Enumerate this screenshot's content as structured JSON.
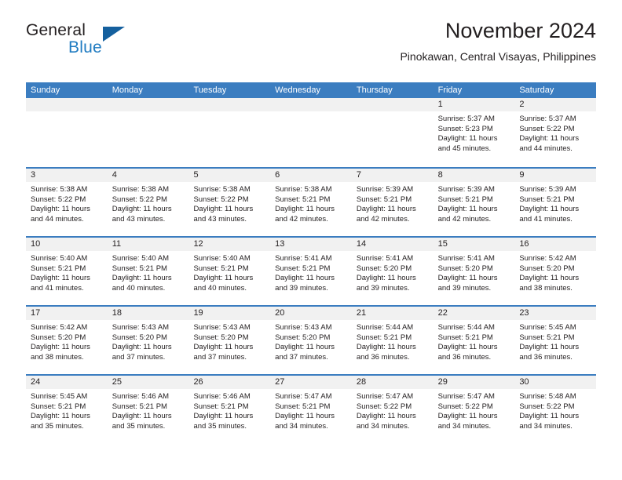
{
  "brand": {
    "name_part1": "General",
    "name_part2": "Blue",
    "flag_icon": "triangle-flag-icon"
  },
  "header": {
    "title": "November 2024",
    "subtitle": "Pinokawan, Central Visayas, Philippines"
  },
  "colors": {
    "header_blue": "#3b7dc0",
    "brand_blue": "#1f7bc1",
    "flag_blue": "#15609e",
    "day_band_gray": "#f1f1f1",
    "text": "#231f20"
  },
  "weekdays": [
    "Sunday",
    "Monday",
    "Tuesday",
    "Wednesday",
    "Thursday",
    "Friday",
    "Saturday"
  ],
  "weeks": [
    [
      {
        "day": "",
        "empty": true
      },
      {
        "day": "",
        "empty": true
      },
      {
        "day": "",
        "empty": true
      },
      {
        "day": "",
        "empty": true
      },
      {
        "day": "",
        "empty": true
      },
      {
        "day": "1",
        "sunrise": "Sunrise: 5:37 AM",
        "sunset": "Sunset: 5:23 PM",
        "daylight": "Daylight: 11 hours and 45 minutes."
      },
      {
        "day": "2",
        "sunrise": "Sunrise: 5:37 AM",
        "sunset": "Sunset: 5:22 PM",
        "daylight": "Daylight: 11 hours and 44 minutes."
      }
    ],
    [
      {
        "day": "3",
        "sunrise": "Sunrise: 5:38 AM",
        "sunset": "Sunset: 5:22 PM",
        "daylight": "Daylight: 11 hours and 44 minutes."
      },
      {
        "day": "4",
        "sunrise": "Sunrise: 5:38 AM",
        "sunset": "Sunset: 5:22 PM",
        "daylight": "Daylight: 11 hours and 43 minutes."
      },
      {
        "day": "5",
        "sunrise": "Sunrise: 5:38 AM",
        "sunset": "Sunset: 5:22 PM",
        "daylight": "Daylight: 11 hours and 43 minutes."
      },
      {
        "day": "6",
        "sunrise": "Sunrise: 5:38 AM",
        "sunset": "Sunset: 5:21 PM",
        "daylight": "Daylight: 11 hours and 42 minutes."
      },
      {
        "day": "7",
        "sunrise": "Sunrise: 5:39 AM",
        "sunset": "Sunset: 5:21 PM",
        "daylight": "Daylight: 11 hours and 42 minutes."
      },
      {
        "day": "8",
        "sunrise": "Sunrise: 5:39 AM",
        "sunset": "Sunset: 5:21 PM",
        "daylight": "Daylight: 11 hours and 42 minutes."
      },
      {
        "day": "9",
        "sunrise": "Sunrise: 5:39 AM",
        "sunset": "Sunset: 5:21 PM",
        "daylight": "Daylight: 11 hours and 41 minutes."
      }
    ],
    [
      {
        "day": "10",
        "sunrise": "Sunrise: 5:40 AM",
        "sunset": "Sunset: 5:21 PM",
        "daylight": "Daylight: 11 hours and 41 minutes."
      },
      {
        "day": "11",
        "sunrise": "Sunrise: 5:40 AM",
        "sunset": "Sunset: 5:21 PM",
        "daylight": "Daylight: 11 hours and 40 minutes."
      },
      {
        "day": "12",
        "sunrise": "Sunrise: 5:40 AM",
        "sunset": "Sunset: 5:21 PM",
        "daylight": "Daylight: 11 hours and 40 minutes."
      },
      {
        "day": "13",
        "sunrise": "Sunrise: 5:41 AM",
        "sunset": "Sunset: 5:21 PM",
        "daylight": "Daylight: 11 hours and 39 minutes."
      },
      {
        "day": "14",
        "sunrise": "Sunrise: 5:41 AM",
        "sunset": "Sunset: 5:20 PM",
        "daylight": "Daylight: 11 hours and 39 minutes."
      },
      {
        "day": "15",
        "sunrise": "Sunrise: 5:41 AM",
        "sunset": "Sunset: 5:20 PM",
        "daylight": "Daylight: 11 hours and 39 minutes."
      },
      {
        "day": "16",
        "sunrise": "Sunrise: 5:42 AM",
        "sunset": "Sunset: 5:20 PM",
        "daylight": "Daylight: 11 hours and 38 minutes."
      }
    ],
    [
      {
        "day": "17",
        "sunrise": "Sunrise: 5:42 AM",
        "sunset": "Sunset: 5:20 PM",
        "daylight": "Daylight: 11 hours and 38 minutes."
      },
      {
        "day": "18",
        "sunrise": "Sunrise: 5:43 AM",
        "sunset": "Sunset: 5:20 PM",
        "daylight": "Daylight: 11 hours and 37 minutes."
      },
      {
        "day": "19",
        "sunrise": "Sunrise: 5:43 AM",
        "sunset": "Sunset: 5:20 PM",
        "daylight": "Daylight: 11 hours and 37 minutes."
      },
      {
        "day": "20",
        "sunrise": "Sunrise: 5:43 AM",
        "sunset": "Sunset: 5:20 PM",
        "daylight": "Daylight: 11 hours and 37 minutes."
      },
      {
        "day": "21",
        "sunrise": "Sunrise: 5:44 AM",
        "sunset": "Sunset: 5:21 PM",
        "daylight": "Daylight: 11 hours and 36 minutes."
      },
      {
        "day": "22",
        "sunrise": "Sunrise: 5:44 AM",
        "sunset": "Sunset: 5:21 PM",
        "daylight": "Daylight: 11 hours and 36 minutes."
      },
      {
        "day": "23",
        "sunrise": "Sunrise: 5:45 AM",
        "sunset": "Sunset: 5:21 PM",
        "daylight": "Daylight: 11 hours and 36 minutes."
      }
    ],
    [
      {
        "day": "24",
        "sunrise": "Sunrise: 5:45 AM",
        "sunset": "Sunset: 5:21 PM",
        "daylight": "Daylight: 11 hours and 35 minutes."
      },
      {
        "day": "25",
        "sunrise": "Sunrise: 5:46 AM",
        "sunset": "Sunset: 5:21 PM",
        "daylight": "Daylight: 11 hours and 35 minutes."
      },
      {
        "day": "26",
        "sunrise": "Sunrise: 5:46 AM",
        "sunset": "Sunset: 5:21 PM",
        "daylight": "Daylight: 11 hours and 35 minutes."
      },
      {
        "day": "27",
        "sunrise": "Sunrise: 5:47 AM",
        "sunset": "Sunset: 5:21 PM",
        "daylight": "Daylight: 11 hours and 34 minutes."
      },
      {
        "day": "28",
        "sunrise": "Sunrise: 5:47 AM",
        "sunset": "Sunset: 5:22 PM",
        "daylight": "Daylight: 11 hours and 34 minutes."
      },
      {
        "day": "29",
        "sunrise": "Sunrise: 5:47 AM",
        "sunset": "Sunset: 5:22 PM",
        "daylight": "Daylight: 11 hours and 34 minutes."
      },
      {
        "day": "30",
        "sunrise": "Sunrise: 5:48 AM",
        "sunset": "Sunset: 5:22 PM",
        "daylight": "Daylight: 11 hours and 34 minutes."
      }
    ]
  ]
}
